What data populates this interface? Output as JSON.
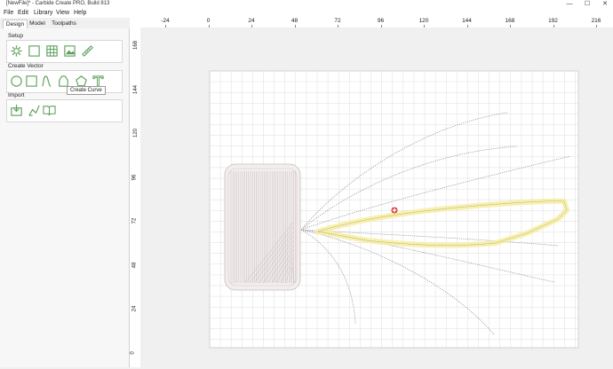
{
  "window": {
    "title": "[NewFile]* - Carbide Create PRO, Build 813",
    "minimize_glyph": "—",
    "maximize_glyph": "☐",
    "close_glyph": "✕"
  },
  "menu": [
    "File",
    "Edit",
    "Library",
    "View",
    "Help"
  ],
  "tabs": [
    "Design",
    "Model",
    "Toolpaths"
  ],
  "active_tab": "Design",
  "sections": {
    "setup": "Setup",
    "create_vector": "Create Vector",
    "import": "Import"
  },
  "setup_tools": [
    "gear-icon",
    "grid-icon",
    "table-grid-icon",
    "image-icon",
    "ruler-icon"
  ],
  "vector_tools": [
    "circle-icon",
    "rectangle-icon",
    "curve-icon",
    "polyline-icon",
    "polygon-icon",
    "text-icon"
  ],
  "import_tools": [
    "import-icon",
    "import-vector-icon",
    "library-book-icon"
  ],
  "tooltip": "Create Curve",
  "ruler_top": [
    "-24",
    "0",
    "24",
    "48",
    "72",
    "96",
    "120",
    "144",
    "168",
    "192",
    "216"
  ],
  "ruler_left": [
    "168",
    "144",
    "120",
    "96",
    "72",
    "48",
    "24",
    "0"
  ],
  "colors": {
    "accent": "#5aa05a",
    "grid_major": "#d6d6d6",
    "grid_minor": "#ececec",
    "highlight": "#f6eda0",
    "toolpath": "#9a8d8d",
    "vector": "#8a8a8a"
  }
}
